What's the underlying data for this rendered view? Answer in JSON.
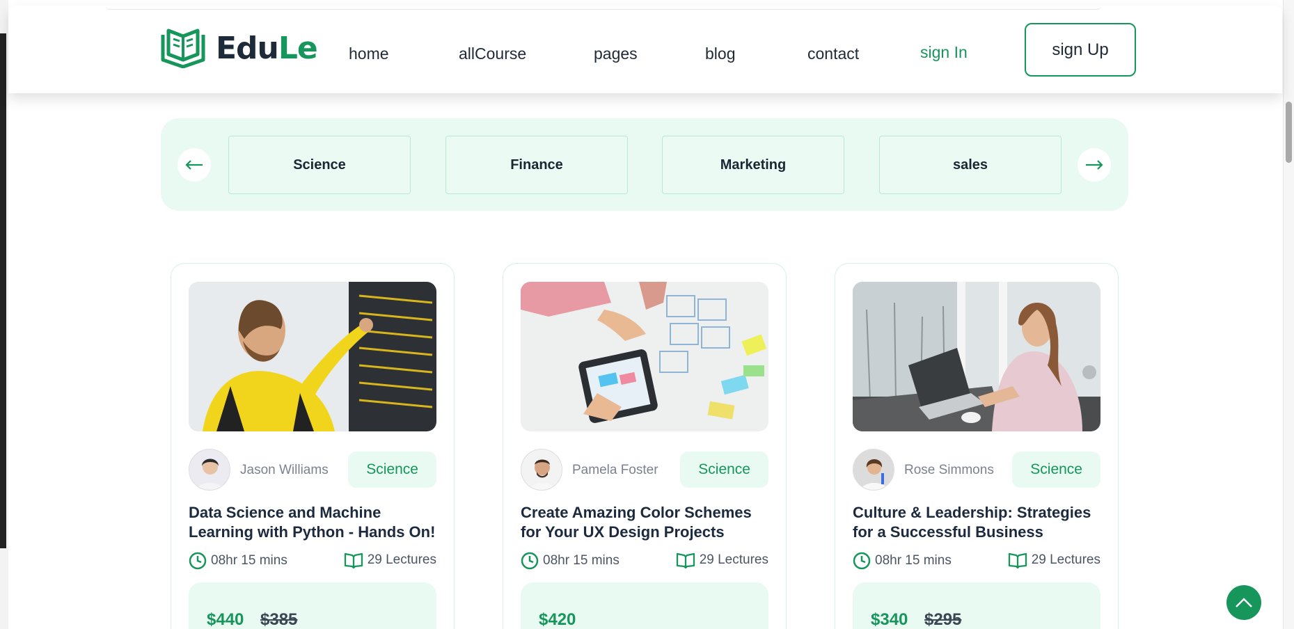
{
  "brand": {
    "part1": "Edu",
    "part2": "Le"
  },
  "nav": {
    "home": "home",
    "all_course": "allCourse",
    "pages": "pages",
    "blog": "blog",
    "contact": "contact",
    "sign_in": "sign In",
    "sign_up": "sign Up"
  },
  "categories": [
    "Science",
    "Finance",
    "Marketing",
    "sales"
  ],
  "courses": [
    {
      "author": "Jason Williams",
      "tag": "Science",
      "title": "Data Science and Machine Learning with Python - Hands On!",
      "duration": "08hr 15 mins",
      "lectures": "29 Lectures",
      "price": "$440",
      "old_price": "$385"
    },
    {
      "author": "Pamela Foster",
      "tag": "Science",
      "title": "Create Amazing Color Schemes for Your UX Design Projects",
      "duration": "08hr 15 mins",
      "lectures": "29 Lectures",
      "price": "$420",
      "old_price": ""
    },
    {
      "author": "Rose Simmons",
      "tag": "Science",
      "title": "Culture & Leadership: Strategies for a Successful Business",
      "duration": "08hr 15 mins",
      "lectures": "29 Lectures",
      "price": "$340",
      "old_price": "$295"
    }
  ],
  "colors": {
    "accent": "#16965a",
    "accent_light": "#e9faf2",
    "text_dark": "#1b2a3e"
  },
  "icons": [
    "logo-book-icon",
    "arrow-left-icon",
    "arrow-right-icon",
    "clock-icon",
    "book-icon",
    "chevron-up-icon"
  ]
}
